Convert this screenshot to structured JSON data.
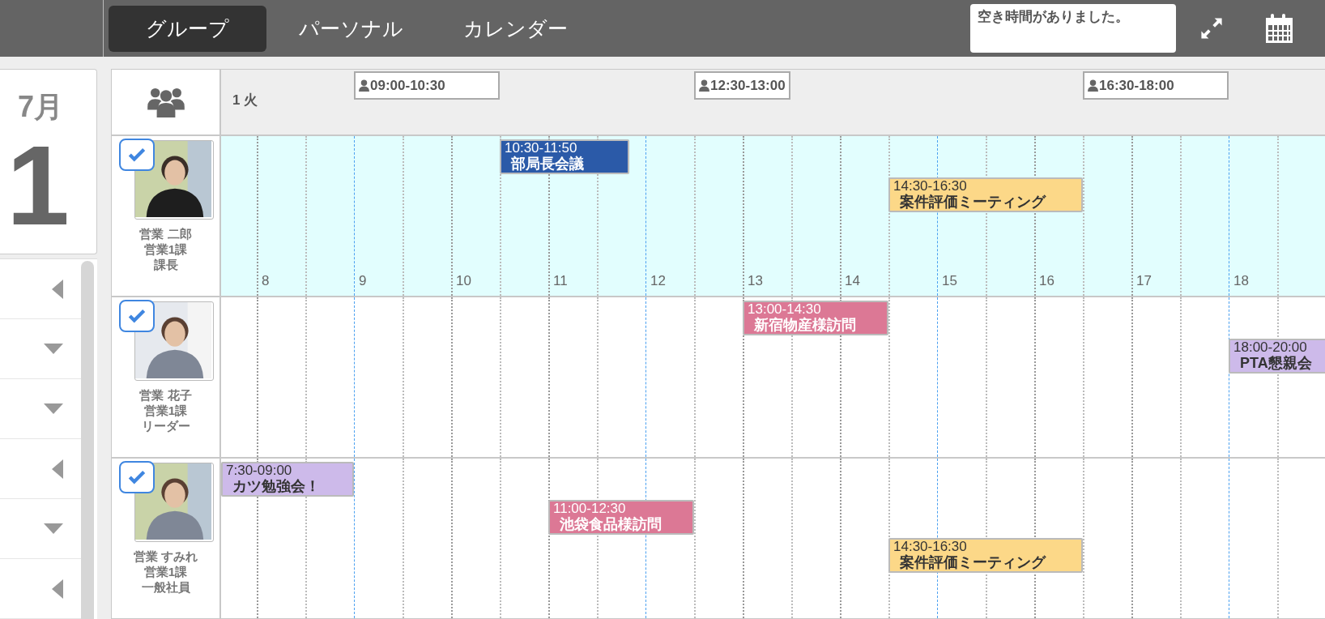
{
  "tabs": [
    {
      "label": "グループ",
      "selected": true
    },
    {
      "label": "パーソナル",
      "selected": false
    },
    {
      "label": "カレンダー",
      "selected": false
    }
  ],
  "notice": "空き時間がありました。",
  "date_card": {
    "month": "7月",
    "day": "1"
  },
  "side_list": [
    {
      "expanded": false
    },
    {
      "expanded": true
    },
    {
      "expanded": true
    },
    {
      "expanded": false
    },
    {
      "expanded": true
    },
    {
      "expanded": false
    }
  ],
  "timeline": {
    "day_label": "1 火",
    "free_slots": [
      "09:00-10:30",
      "12:30-13:00",
      "16:30-18:00"
    ],
    "hours": [
      "8",
      "9",
      "10",
      "11",
      "12",
      "13",
      "14",
      "15",
      "16",
      "17",
      "18"
    ]
  },
  "people": [
    {
      "name": "営業 二郎",
      "dept": "営業1課",
      "title": "課長",
      "checked": true,
      "selected": true,
      "events": [
        {
          "time": "10:30-11:50",
          "title": "部局長会議",
          "color": "#2b5aa8"
        },
        {
          "time": "14:30-16:30",
          "title": "案件評価ミーティング",
          "color": "#fcd888"
        }
      ]
    },
    {
      "name": "営業 花子",
      "dept": "営業1課",
      "title": "リーダー",
      "checked": true,
      "selected": false,
      "events": [
        {
          "time": "13:00-14:30",
          "title": "新宿物産様訪問",
          "color": "#dc7895"
        },
        {
          "time": "18:00-20:00",
          "title": "PTA懇親会",
          "color": "#cdbaea"
        }
      ]
    },
    {
      "name": "営業 すみれ",
      "dept": "営業1課",
      "title": "一般社員",
      "checked": true,
      "selected": false,
      "events": [
        {
          "time": "7:30-09:00",
          "title": "カツ勉強会！",
          "color": "#cdbaea"
        },
        {
          "time": "11:00-12:30",
          "title": "池袋食品様訪問",
          "color": "#dc7895"
        },
        {
          "time": "14:30-16:30",
          "title": "案件評価ミーティング",
          "color": "#fcd888"
        }
      ]
    }
  ]
}
